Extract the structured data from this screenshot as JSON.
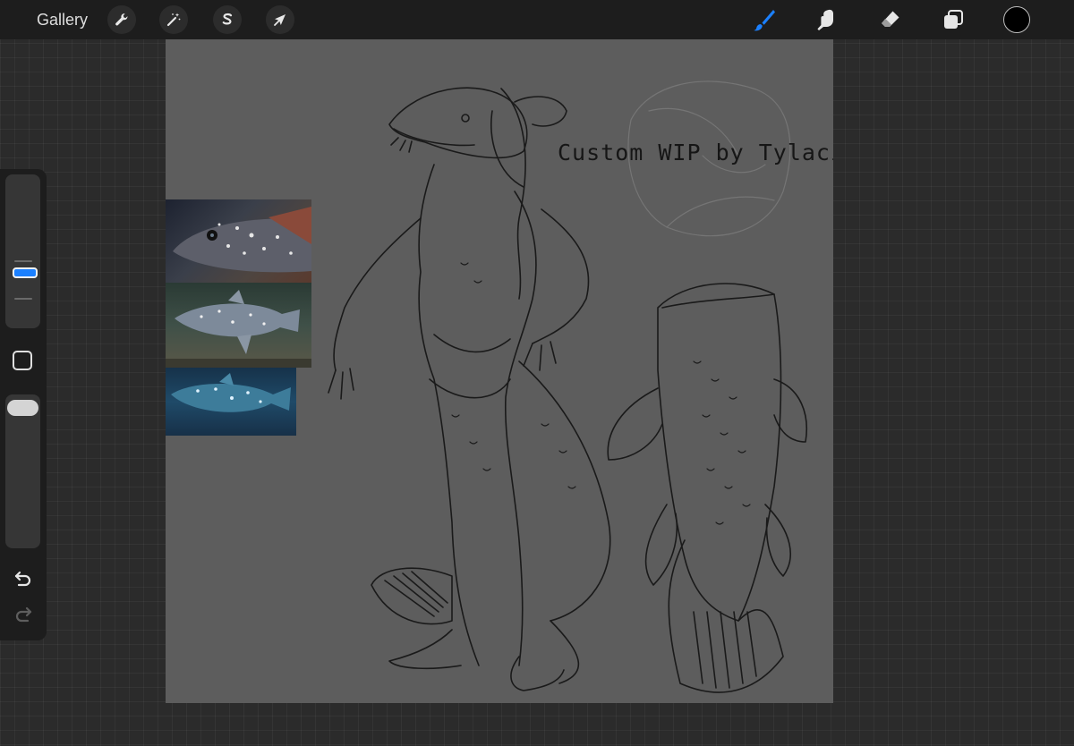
{
  "topbar": {
    "gallery_label": "Gallery",
    "left_tools": [
      {
        "name": "actions",
        "icon": "wrench-icon"
      },
      {
        "name": "adjustments",
        "icon": "magic-wand-icon"
      },
      {
        "name": "selection",
        "icon": "selection-s-icon"
      },
      {
        "name": "transform",
        "icon": "arrow-cursor-icon"
      }
    ],
    "right_tools": [
      {
        "name": "brush",
        "icon": "brush-icon",
        "active": true
      },
      {
        "name": "smudge",
        "icon": "smudge-finger-icon",
        "active": false
      },
      {
        "name": "eraser",
        "icon": "eraser-icon",
        "active": false
      },
      {
        "name": "layers",
        "icon": "layers-icon",
        "active": false
      }
    ],
    "current_color": "#000000",
    "active_tool_color": "#1b80ff"
  },
  "sidebar": {
    "brush_size_level": 0.5,
    "brush_opacity_level": 1.0,
    "modify_icon": "square-modify-icon",
    "undo_icon": "undo-arrow-icon",
    "redo_icon": "redo-arrow-icon"
  },
  "canvas": {
    "artwork_text": "Custom WIP by Tylacine",
    "background_color": "#5d5d5d",
    "reference_photos": [
      {
        "name": "coelacanth-photo-1",
        "subject": "coelacanth close-up head"
      },
      {
        "name": "coelacanth-photo-2",
        "subject": "coelacanth on rocks"
      },
      {
        "name": "coelacanth-photo-3",
        "subject": "coelacanth in blue water"
      }
    ]
  }
}
